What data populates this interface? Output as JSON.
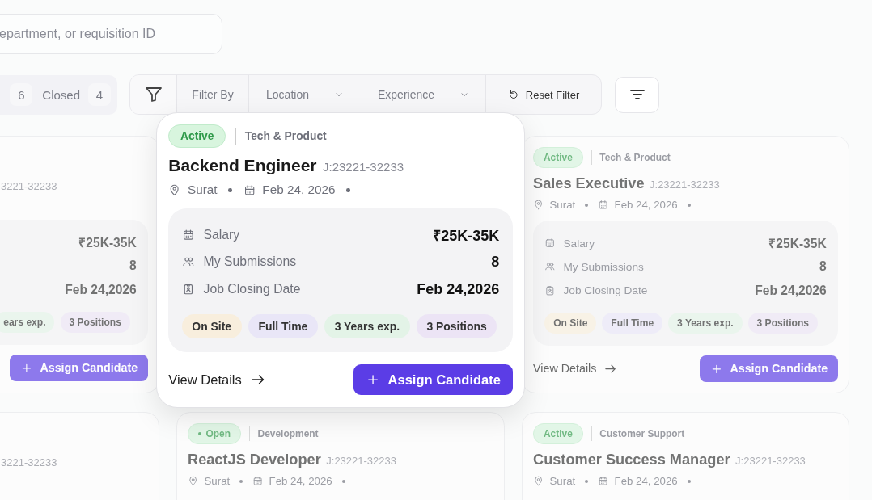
{
  "search": {
    "placeholder": "epartment, or requisition ID"
  },
  "status_tabs": [
    {
      "count": "6",
      "selected": false
    },
    {
      "label": "Closed",
      "count": "4",
      "selected": false
    }
  ],
  "filter_bar": [
    {
      "kind": "label",
      "text": "Filter By"
    },
    {
      "kind": "dropdown",
      "text": "Location"
    },
    {
      "kind": "dropdown",
      "text": "Experience"
    },
    {
      "kind": "reset",
      "text": "Reset Filter"
    }
  ],
  "cut_cards": [
    {
      "job_id": "3221-32233",
      "details": [
        "₹25K-35K",
        "8",
        "Feb 24,2026"
      ],
      "tags": [
        {
          "label": "ears exp.",
          "color": "#e3f3e7"
        },
        {
          "label": "3 Positions",
          "color": "#ece4f5"
        }
      ],
      "button": "Assign Candidate"
    },
    {
      "job_id": "3221-32233"
    }
  ],
  "focused_card": {
    "status": {
      "label": "Active",
      "kind": "active"
    },
    "department": "Tech & Product",
    "title": "Backend Engineer",
    "job_id": "J:23221-32233",
    "location": "Surat",
    "date": "Feb 24, 2026",
    "details": [
      {
        "label": "Salary",
        "value": "₹25K-35K"
      },
      {
        "label": "My Submissions",
        "value": "8"
      },
      {
        "label": "Job Closing Date",
        "value": "Feb 24,2026"
      }
    ],
    "tags": [
      {
        "label": "On Site",
        "color": "#f8eedd"
      },
      {
        "label": "Full Time",
        "color": "#e9e6f7"
      },
      {
        "label": "3 Years exp.",
        "color": "#e3f3e7"
      },
      {
        "label": "3 Positions",
        "color": "#ece4f5"
      }
    ],
    "link": "View Details",
    "button": "Assign Candidate"
  },
  "cards": [
    {
      "status": {
        "label": "Active",
        "kind": "active"
      },
      "department": "Tech & Product",
      "title": "Sales Executive",
      "job_id": "J:23221-32233",
      "location": "Surat",
      "date": "Feb 24, 2026",
      "details": [
        {
          "label": "Salary",
          "value": "₹25K-35K"
        },
        {
          "label": "My Submissions",
          "value": "8"
        },
        {
          "label": "Job Closing Date",
          "value": "Feb 24,2026"
        }
      ],
      "tags": [
        {
          "label": "On Site",
          "color": "#f8eedd"
        },
        {
          "label": "Full Time",
          "color": "#e9e6f7"
        },
        {
          "label": "3 Years exp.",
          "color": "#e3f3e7"
        },
        {
          "label": "3 Positions",
          "color": "#ece4f5"
        }
      ],
      "link": "View Details",
      "button": "Assign Candidate"
    },
    {
      "status": {
        "label": "Open",
        "kind": "open"
      },
      "department": "Development",
      "title": "ReactJS Developer",
      "job_id": "J:23221-32233",
      "location": "Surat",
      "date": "Feb 24, 2026"
    },
    {
      "status": {
        "label": "Active",
        "kind": "active"
      },
      "department": "Customer Support",
      "title": "Customer Success Manager",
      "job_id": "J:23221-32233",
      "location": "Surat",
      "date": "Feb 24, 2026"
    }
  ]
}
